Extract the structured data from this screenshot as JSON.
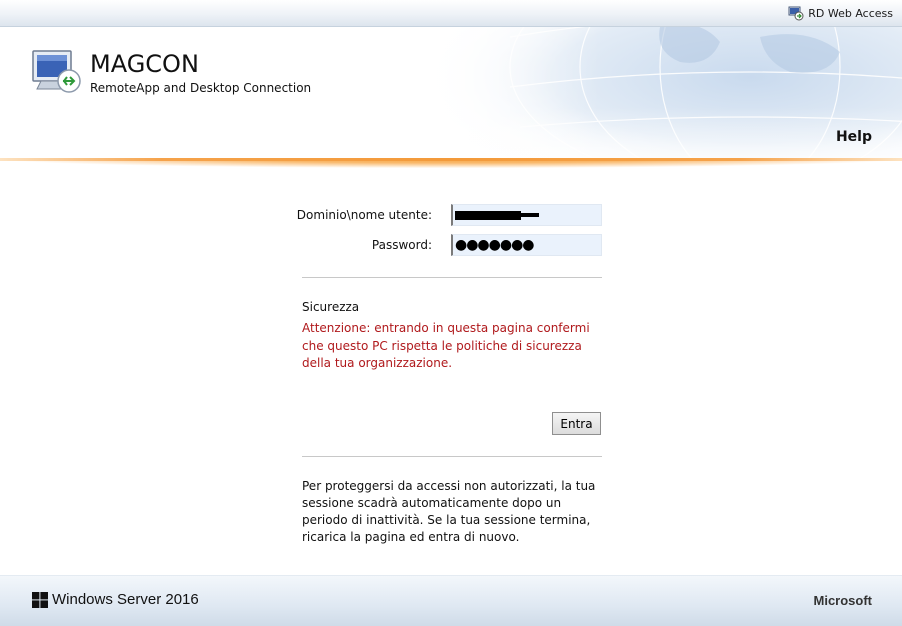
{
  "topbar": {
    "rd_web_access": "RD Web Access",
    "icon": "rd-web-access-icon"
  },
  "header": {
    "title": "MAGCON",
    "subtitle": "RemoteApp and Desktop Connection",
    "help": "Help",
    "logo_icon": "remoteapp-computer-icon"
  },
  "login": {
    "username_label": "Dominio\\nome utente:",
    "password_label": "Password:",
    "password_value": "●●●●●●●"
  },
  "security": {
    "title": "Sicurezza",
    "warning": "Attenzione: entrando in questa pagina confermi che questo PC rispetta le politiche di sicurezza della tua organizzazione."
  },
  "submit_label": "Entra",
  "session_note": "Per proteggersi da accessi non autorizzati, la tua sessione scadrà automaticamente dopo un periodo di inattività. Se la tua sessione termina, ricarica la pagina ed entra di nuovo.",
  "footer": {
    "windows_server": "Windows Server 2016",
    "microsoft": "Microsoft",
    "logo_icon": "windows-logo-icon"
  },
  "colors": {
    "accent_orange": "#f39a3a",
    "warning_red": "#b0191c",
    "field_bg": "#eaf2fc"
  }
}
